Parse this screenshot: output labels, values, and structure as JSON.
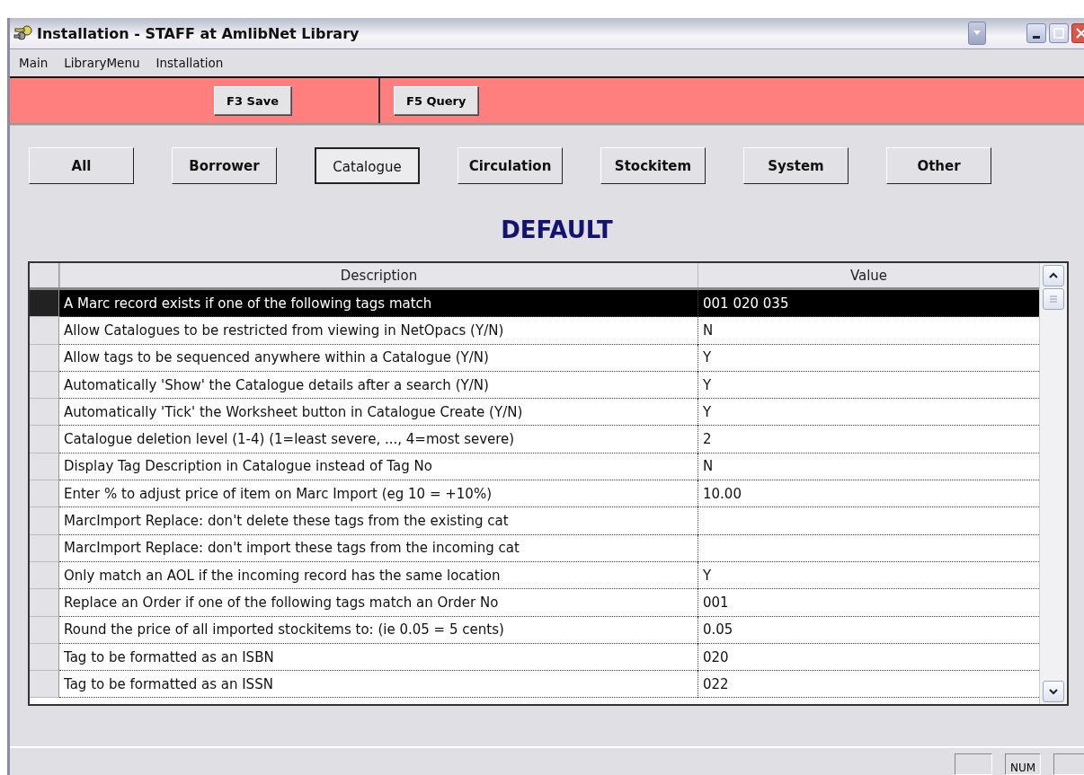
{
  "window": {
    "title": "Installation - STAFF at AmlibNet Library"
  },
  "menu": [
    "Main",
    "LibraryMenu",
    "Installation"
  ],
  "toolbar": [
    "F3 Save",
    "F5 Query"
  ],
  "filters": [
    {
      "label": "All",
      "selected": false
    },
    {
      "label": "Borrower",
      "selected": false
    },
    {
      "label": "Catalogue",
      "selected": true
    },
    {
      "label": "Circulation",
      "selected": false
    },
    {
      "label": "Stockitem",
      "selected": false
    },
    {
      "label": "System",
      "selected": false
    },
    {
      "label": "Other",
      "selected": false
    }
  ],
  "heading": "DEFAULT",
  "table": {
    "columns": [
      "Description",
      "Value"
    ],
    "rows": [
      {
        "description": "A Marc record exists if one of the following tags match",
        "value": "001 020 035",
        "selected": true
      },
      {
        "description": "Allow Catalogues to be restricted from viewing in NetOpacs (Y/N)",
        "value": "N",
        "selected": false
      },
      {
        "description": "Allow tags to be sequenced anywhere within a Catalogue (Y/N)",
        "value": "Y",
        "selected": false
      },
      {
        "description": "Automatically 'Show' the Catalogue details after a search (Y/N)",
        "value": "Y",
        "selected": false
      },
      {
        "description": "Automatically 'Tick' the Worksheet button in Catalogue Create (Y/N)",
        "value": "Y",
        "selected": false
      },
      {
        "description": "Catalogue deletion level (1-4) (1=least severe, ..., 4=most severe)",
        "value": "2",
        "selected": false
      },
      {
        "description": "Display Tag Description in Catalogue instead of Tag No",
        "value": "N",
        "selected": false
      },
      {
        "description": "Enter % to adjust price of item on Marc Import (eg 10 = +10%)",
        "value": "10.00",
        "selected": false
      },
      {
        "description": "MarcImport Replace: don't delete these tags from the existing cat",
        "value": "",
        "selected": false
      },
      {
        "description": "MarcImport Replace: don't import these tags from the incoming cat",
        "value": "",
        "selected": false
      },
      {
        "description": "Only match an AOL if the incoming record has the same location",
        "value": "Y",
        "selected": false
      },
      {
        "description": "Replace an Order if one of the following tags match an Order No",
        "value": "001",
        "selected": false
      },
      {
        "description": "Round the price of all imported stockitems to: (ie 0.05 = 5 cents)",
        "value": "0.05",
        "selected": false
      },
      {
        "description": "Tag to be formatted as an ISBN",
        "value": "020",
        "selected": false
      },
      {
        "description": "Tag to be formatted as an ISSN",
        "value": "022",
        "selected": false
      }
    ]
  },
  "status_bar": {
    "indicator": "NUM"
  }
}
